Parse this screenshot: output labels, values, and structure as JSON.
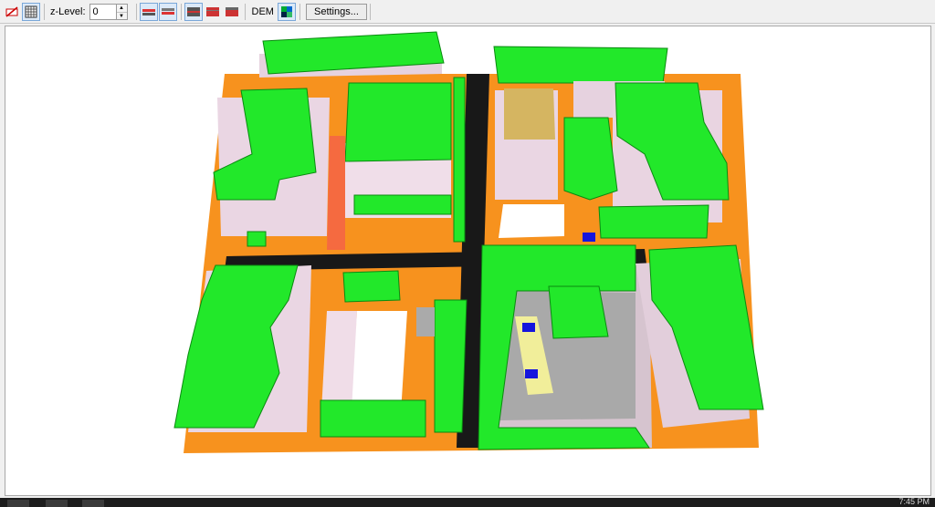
{
  "toolbar": {
    "zlevel_label": "z-Level:",
    "zlevel_value": "0",
    "dem_label": "DEM",
    "settings_label": "Settings..."
  },
  "statusbar": {
    "time": "7:45 PM"
  },
  "colors": {
    "vegetation": "#22e82a",
    "building_wall": "#ecd9e6",
    "ground": "#f7921e",
    "street": "#181818",
    "water": "#1515dd",
    "path": "#f1ee9a",
    "roof_brown": "#d5b561"
  }
}
